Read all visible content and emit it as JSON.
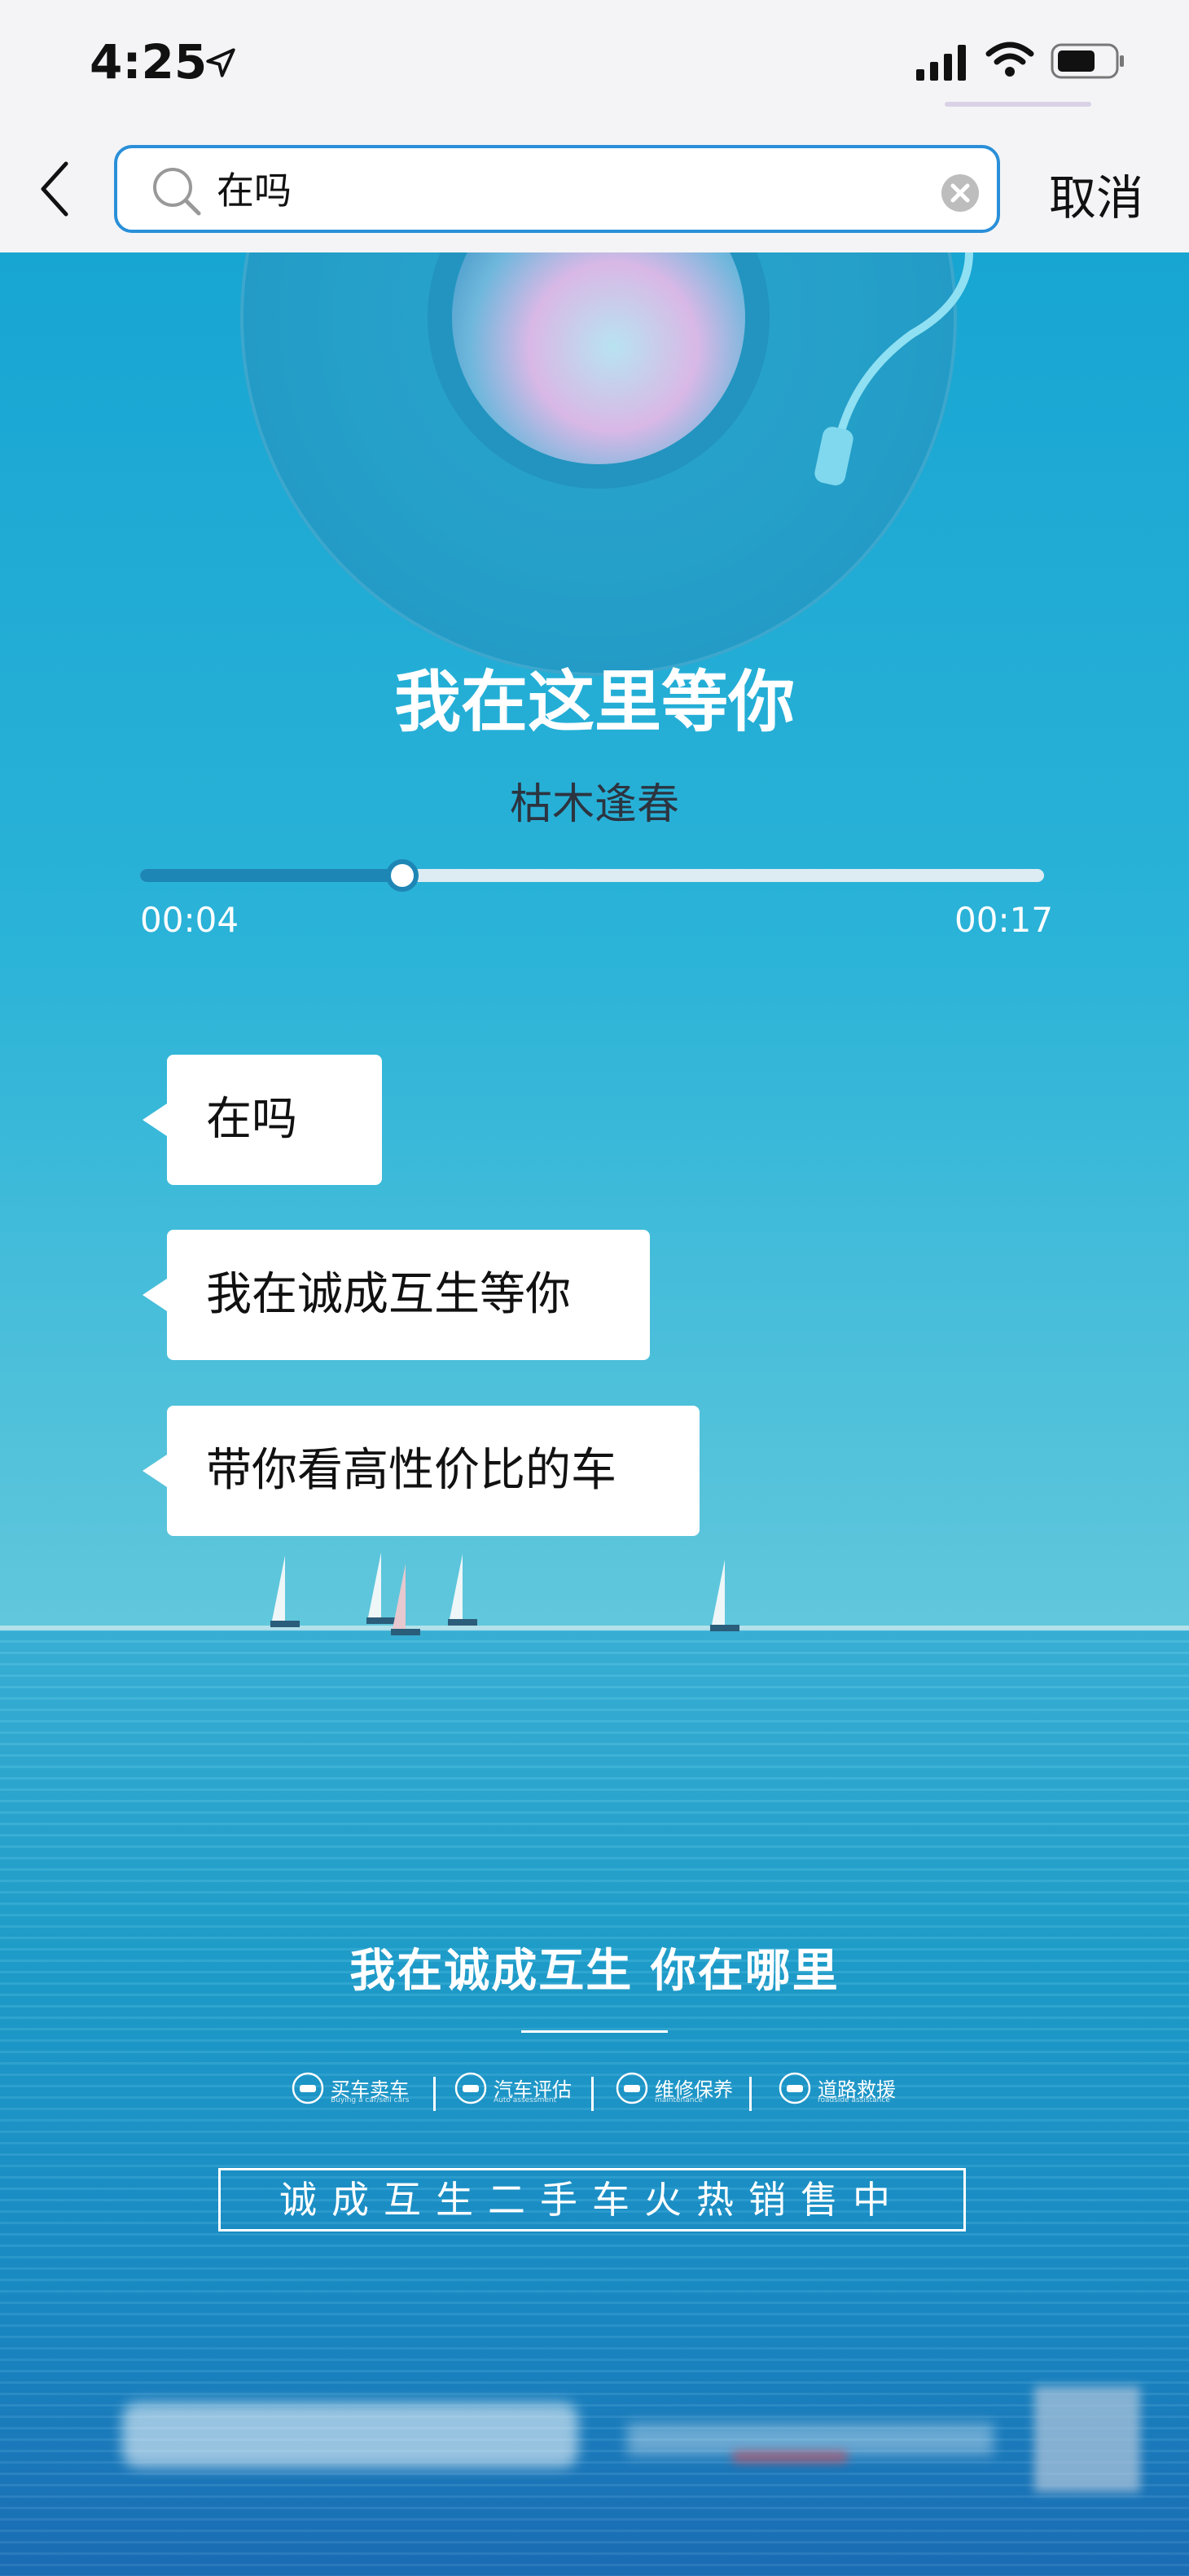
{
  "status": {
    "time": "4:25"
  },
  "nav": {
    "search_value": "在吗",
    "cancel_label": "取消"
  },
  "player": {
    "title": "我在这里等你",
    "artist": "枯木逢春",
    "current_time": "00:04",
    "total_time": "00:17",
    "progress_fraction": 0.29
  },
  "chat": {
    "messages": [
      "在吗",
      "我在诚成互生等你",
      "带你看高性价比的车"
    ]
  },
  "ad": {
    "slogan": "我在诚成互生 你在哪里",
    "services": [
      {
        "label": "买车卖车",
        "sub": "Buying a car/sell cars"
      },
      {
        "label": "汽车评估",
        "sub": "Auto assessment"
      },
      {
        "label": "维修保养",
        "sub": "maintenance"
      },
      {
        "label": "道路救援",
        "sub": "roadside assistance"
      }
    ],
    "banner": "诚成互生二手车火热销售中"
  },
  "colors": {
    "accent": "#2a8fd8",
    "progress": "#1e86b5"
  }
}
